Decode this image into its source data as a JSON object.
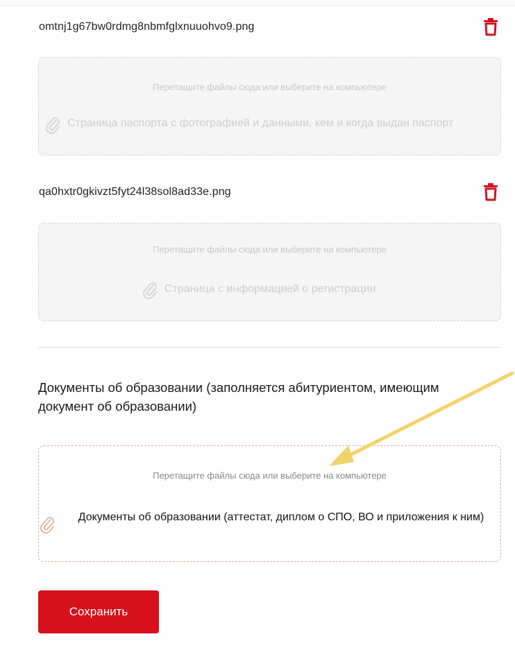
{
  "files": [
    {
      "name": "omtnj1g67bw0rdmg8nbmfglxnuuohvo9.png"
    },
    {
      "name": "qa0hxtr0gkivzt5fyt24l38sol8ad33e.png"
    }
  ],
  "dropzones": {
    "passport_photo": {
      "hint": "Перетащите файлы сюда или выберите на компьютере",
      "label": "Страница паспорта с фотографией и данными, кем и когда выдан паспорт"
    },
    "registration": {
      "hint": "Перетащите файлы сюда или выберите на компьютере",
      "label": "Страница с информацией о регистрации"
    },
    "education": {
      "hint": "Перетащите файлы сюда или выберите на компьютере",
      "label": "Документы об образовании (аттестат, диплом о СПО, ВО и приложения к ним)"
    }
  },
  "section": {
    "title": "Документы об образовании (заполняется абитуриентом, имеющим документ об образовании)"
  },
  "actions": {
    "save_label": "Сохранить"
  },
  "icons": {
    "delete": "trash-icon",
    "attachment": "paperclip-icon",
    "annotation": "yellow-arrow"
  },
  "colors": {
    "accent": "#d6111c",
    "annotation_arrow": "#f1d36b",
    "dropzone_active_border": "#e4a79d"
  }
}
